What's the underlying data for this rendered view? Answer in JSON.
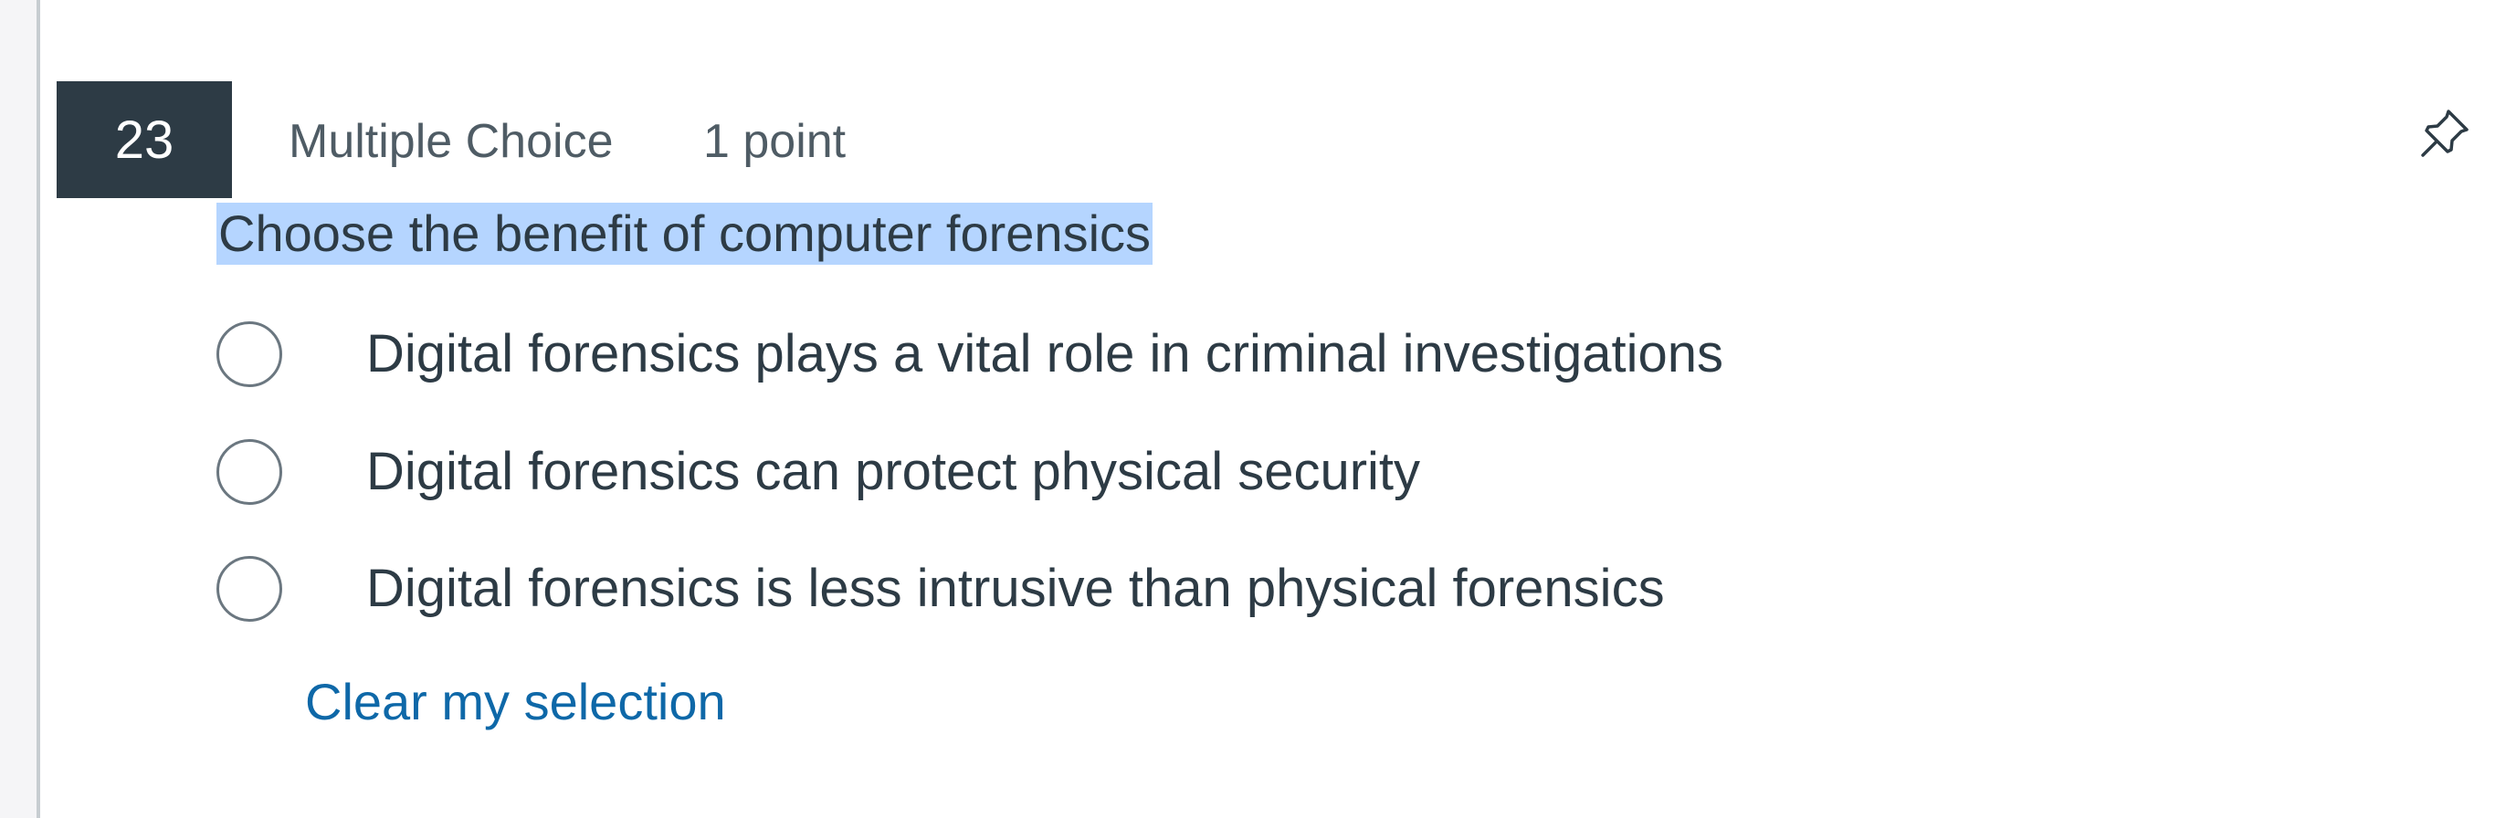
{
  "question": {
    "number": "23",
    "type_label": "Multiple Choice",
    "points_label": "1 point",
    "text": "Choose the benefit of computer forensics",
    "answers": [
      {
        "label": "Digital forensics plays a vital role in criminal investigations",
        "selected": false
      },
      {
        "label": "Digital forensics can protect physical security",
        "selected": false
      },
      {
        "label": "Digital forensics is less intrusive than physical forensics",
        "selected": false
      }
    ],
    "clear_label": "Clear my selection",
    "pin_icon": "pin-icon"
  },
  "colors": {
    "number_badge_bg": "#2d3b45",
    "text_highlight": "#b5d5ff",
    "link": "#0e68a8",
    "text": "#2d3b45",
    "meta_text": "#4f5c65"
  }
}
